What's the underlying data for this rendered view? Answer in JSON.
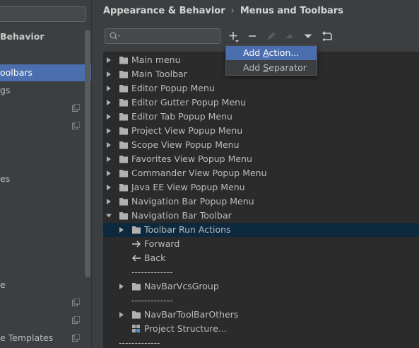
{
  "sidebar": {
    "section_label": "Behavior",
    "items": [
      {
        "label": "oolbars",
        "selected": true
      },
      {
        "label": "gs"
      },
      {
        "label": ""
      },
      {
        "label": ""
      },
      {
        "label": "es"
      },
      {
        "label": "e"
      },
      {
        "label": ""
      },
      {
        "label": ""
      },
      {
        "label": "e Templates"
      }
    ]
  },
  "breadcrumb": {
    "parent": "Appearance & Behavior",
    "separator": "›",
    "current": "Menus and Toolbars"
  },
  "toolbar": {
    "search_value": "",
    "buttons": [
      "add-icon",
      "remove-icon",
      "edit-icon",
      "move-up-icon",
      "move-down-icon",
      "restore-icon"
    ]
  },
  "popup": {
    "items": [
      {
        "pre": "Add ",
        "mn": "A",
        "post": "ction...",
        "active": true
      },
      {
        "pre": "Add ",
        "mn": "S",
        "post": "eparator",
        "active": false
      }
    ]
  },
  "tree": {
    "items": [
      {
        "label": "Main menu",
        "type": "folder",
        "expanded": false
      },
      {
        "label": "Main Toolbar",
        "type": "folder",
        "expanded": false
      },
      {
        "label": "Editor Popup Menu",
        "type": "folder",
        "expanded": false
      },
      {
        "label": "Editor Gutter Popup Menu",
        "type": "folder",
        "expanded": false
      },
      {
        "label": "Editor Tab Popup Menu",
        "type": "folder",
        "expanded": false
      },
      {
        "label": "Project View Popup Menu",
        "type": "folder",
        "expanded": false
      },
      {
        "label": "Scope View Popup Menu",
        "type": "folder",
        "expanded": false
      },
      {
        "label": "Favorites View Popup Menu",
        "type": "folder",
        "expanded": false
      },
      {
        "label": "Commander View Popup Menu",
        "type": "folder",
        "expanded": false
      },
      {
        "label": "Java EE View Popup Menu",
        "type": "folder",
        "expanded": false
      },
      {
        "label": "Navigation Bar Popup Menu",
        "type": "folder",
        "expanded": false
      },
      {
        "label": "Navigation Bar Toolbar",
        "type": "folder",
        "expanded": true
      },
      {
        "label": "Toolbar Run Actions",
        "type": "folder",
        "expanded": false,
        "selected": true
      },
      {
        "label": "Forward",
        "type": "forward-icon"
      },
      {
        "label": "Back",
        "type": "back-icon"
      },
      {
        "label": "-------------",
        "type": "separator"
      },
      {
        "label": "NavBarVcsGroup",
        "type": "folder",
        "expanded": false
      },
      {
        "label": "-------------",
        "type": "separator"
      },
      {
        "label": "NavBarToolBarOthers",
        "type": "folder",
        "expanded": false
      },
      {
        "label": "Project Structure...",
        "type": "project-structure-icon"
      },
      {
        "label": "-------------",
        "type": "separator"
      }
    ]
  },
  "colors": {
    "background": "#2b2b2b",
    "panel": "#3c3f41",
    "selection": "#4b6eaf",
    "tree_selection": "#0d293e",
    "text": "#bbbbbb"
  }
}
